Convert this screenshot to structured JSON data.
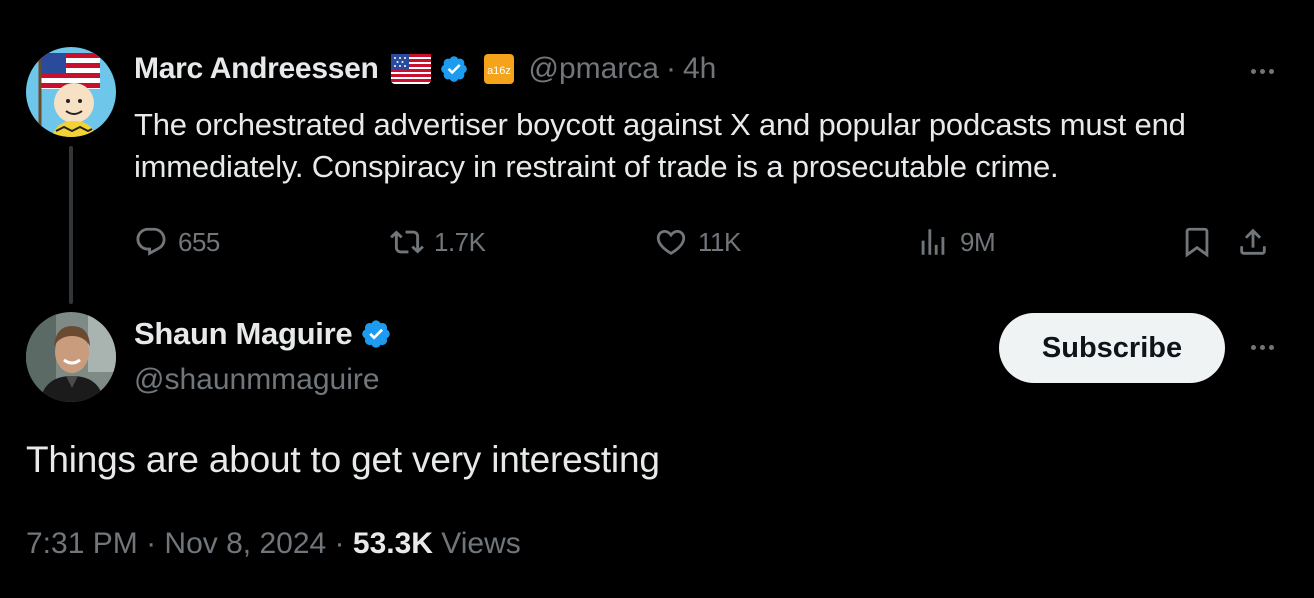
{
  "parent_tweet": {
    "author_name": "Marc Andreessen",
    "affiliation_label": "a16z",
    "handle": "@pmarca",
    "separator": "·",
    "time": "4h",
    "text": "The orchestrated advertiser boycott against X and popular podcasts must end immediately. Conspiracy in restraint of trade is a prosecutable crime.",
    "replies": "655",
    "reposts": "1.7K",
    "likes": "11K",
    "views": "9M"
  },
  "reply_tweet": {
    "author_name": "Shaun Maguire",
    "handle": "@shaunmmaguire",
    "subscribe_label": "Subscribe",
    "text": "Things are about to get very interesting",
    "time": "7:31 PM",
    "separator": "·",
    "date": "Nov 8, 2024",
    "views_count": "53.3K",
    "views_label": "Views"
  },
  "colors": {
    "background": "#000000",
    "primary_text": "#e7e9ea",
    "secondary_text": "#71767b",
    "verified_blue": "#1d9bf0",
    "button_bg": "#eff3f4"
  }
}
